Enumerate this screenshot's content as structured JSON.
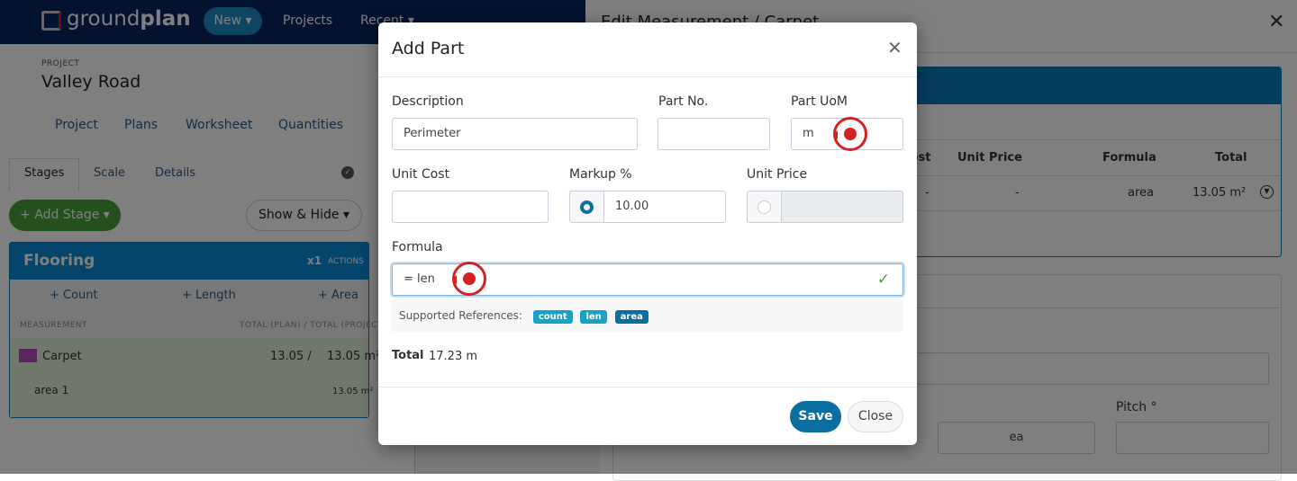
{
  "nav": {
    "brand_light": "ground",
    "brand_bold": "plan",
    "new_label": "New ▾",
    "projects": "Projects",
    "recent": "Recent ▾"
  },
  "project": {
    "eyebrow": "PROJECT",
    "name": "Valley Road",
    "tabs": [
      "Project",
      "Plans",
      "Worksheet",
      "Quantities"
    ]
  },
  "subtabs": [
    "Stages",
    "Scale",
    "Details"
  ],
  "buttons": {
    "add_stage": "+ Add Stage ▾",
    "show_hide": "Show & Hide ▾"
  },
  "stage": {
    "title": "Flooring",
    "multiplier": "x1",
    "actions": "ACTIONS",
    "add": [
      "+ Count",
      "+ Length",
      "+ Area"
    ],
    "col_measurement": "MEASUREMENT",
    "col_total": "TOTAL (PLAN) / TOTAL (PROJECT)",
    "row": {
      "name": "Carpet",
      "color": "#b04cb8",
      "plan_total": "13.05 /",
      "project_total": "13.05 m²"
    },
    "sub": {
      "name": "area 1",
      "total": "13.05 m²"
    }
  },
  "edit_panel": {
    "title": "Edit Measurement / Carpet",
    "columns": [
      "Cost",
      "Unit Price",
      "Formula",
      "Total"
    ],
    "row": [
      "-",
      "-",
      "area",
      "13.05 m²"
    ],
    "pitch_label": "Pitch °",
    "unit": "ea"
  },
  "modal": {
    "title": "Add Part",
    "description_label": "Description",
    "description_value": "Perimeter",
    "partno_label": "Part No.",
    "partno_value": "",
    "uom_label": "Part UoM",
    "uom_value": "m",
    "unitcost_label": "Unit Cost",
    "unitcost_value": "",
    "markup_label": "Markup %",
    "markup_value": "10.00",
    "markup_selected": true,
    "unitprice_label": "Unit Price",
    "unitprice_value": "",
    "formula_label": "Formula",
    "formula_value": "= len",
    "refs_label": "Supported References:",
    "refs": [
      "count",
      "len",
      "area"
    ],
    "total_label": "Total",
    "total_value": "17.23 m",
    "save": "Save",
    "close": "Close"
  },
  "colors": {
    "accent": "#0a6fa0",
    "badge_light": "#17a2c8",
    "badge_dark": "#0a6fa0",
    "marker": "#d42020",
    "valid": "#4aa03a"
  }
}
